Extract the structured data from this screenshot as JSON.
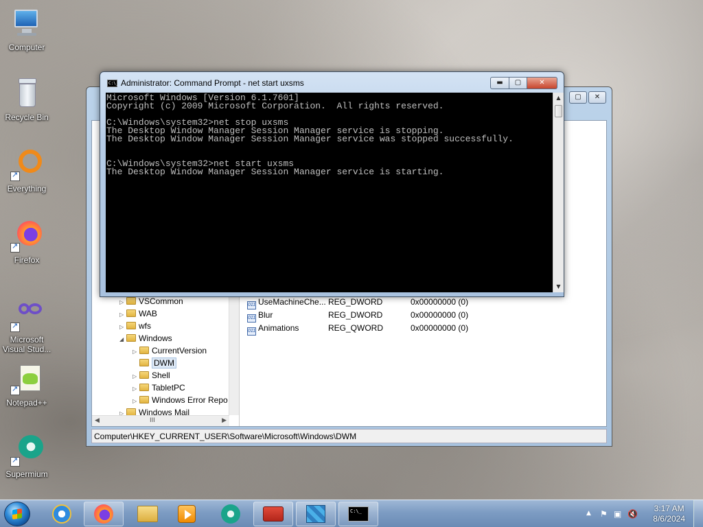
{
  "desktop": {
    "icons": [
      {
        "label": "Computer"
      },
      {
        "label": "Recycle Bin"
      },
      {
        "label": "Everything"
      },
      {
        "label": "Firefox"
      },
      {
        "label": "Microsoft Visual Stud..."
      },
      {
        "label": "Notepad++"
      },
      {
        "label": "Supermium"
      }
    ]
  },
  "cmd": {
    "title": "Administrator: Command Prompt - net  start uxsms",
    "icon_text": "C:\\_",
    "lines": [
      "Microsoft Windows [Version 6.1.7601]",
      "Copyright (c) 2009 Microsoft Corporation.  All rights reserved.",
      "",
      "C:\\Windows\\system32>net stop uxsms",
      "The Desktop Window Manager Session Manager service is stopping.",
      "The Desktop Window Manager Session Manager service was stopped successfully.",
      "",
      "",
      "C:\\Windows\\system32>net start uxsms",
      "The Desktop Window Manager Session Manager service is starting."
    ],
    "buttons": {
      "minimize": "▬",
      "maximize": "▢",
      "close": "✕"
    }
  },
  "regedit": {
    "buttons": {
      "maximize": "▢",
      "close": "✕"
    },
    "tree": [
      {
        "label": "VSCommon",
        "indent": 1,
        "toggle": "▷"
      },
      {
        "label": "WAB",
        "indent": 1,
        "toggle": "▷"
      },
      {
        "label": "wfs",
        "indent": 1,
        "toggle": "▷"
      },
      {
        "label": "Windows",
        "indent": 1,
        "toggle": "◢"
      },
      {
        "label": "CurrentVersion",
        "indent": 2,
        "toggle": "▷"
      },
      {
        "label": "DWM",
        "indent": 2,
        "toggle": ""
      },
      {
        "label": "Shell",
        "indent": 2,
        "toggle": "▷"
      },
      {
        "label": "TabletPC",
        "indent": 2,
        "toggle": "▷"
      },
      {
        "label": "Windows Error Repo",
        "indent": 2,
        "toggle": "▷"
      },
      {
        "label": "Windows Mail",
        "indent": 1,
        "toggle": "▷"
      }
    ],
    "values": [
      {
        "name": "UseMachineChe...",
        "type": "REG_DWORD",
        "data": "0x00000000 (0)"
      },
      {
        "name": "Blur",
        "type": "REG_DWORD",
        "data": "0x00000000 (0)"
      },
      {
        "name": "Animations",
        "type": "REG_QWORD",
        "data": "0x00000000 (0)"
      }
    ],
    "hscroll_thumb": "III",
    "status": "Computer\\HKEY_CURRENT_USER\\Software\\Microsoft\\Windows\\DWM"
  },
  "taskbar": {
    "apps": [
      "internet-explorer",
      "firefox",
      "file-explorer",
      "media-player",
      "supermium",
      "toolbox",
      "registry-editor",
      "command-prompt"
    ],
    "cmd_glyph": "C:\\_",
    "tray": {
      "arrow": "▲",
      "time": "3:17 AM",
      "date": "8/6/2024"
    }
  }
}
